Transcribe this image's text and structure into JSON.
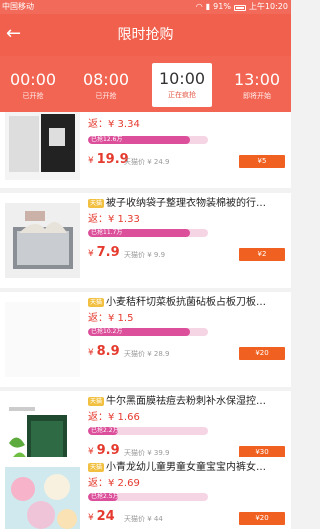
{
  "status_bar": {
    "carrier": "中国移动",
    "battery": "91%",
    "time": "上午10:20"
  },
  "header": {
    "back_glyph": "←",
    "title": "限时抢购"
  },
  "tabs": [
    {
      "time": "00:00",
      "status": "已开抢",
      "active": false
    },
    {
      "time": "08:00",
      "status": "已开抢",
      "active": false
    },
    {
      "time": "10:00",
      "status": "正在疯抢",
      "active": true
    },
    {
      "time": "13:00",
      "status": "即将开始",
      "active": false
    }
  ],
  "colors": {
    "accent": "#f0604c",
    "price": "#e53a2e",
    "progress": "#dc4f9a",
    "button": "#f06020"
  },
  "items": [
    {
      "tag": "",
      "title": "",
      "rebate": "返：¥ 3.34",
      "sold": "已抢12.6万",
      "sold_fraction": 0.85,
      "currency": "¥",
      "price": "19.9",
      "tmall_price": "天猫价 ¥ 24.9",
      "button": "¥5",
      "thumb": "box"
    },
    {
      "tag": "天猫",
      "title": "被子收纳袋子整理衣物装棉被的行…",
      "rebate": "返：¥ 1.33",
      "sold": "已抢11.7万",
      "sold_fraction": 0.85,
      "currency": "¥",
      "price": "7.9",
      "tmall_price": "天猫价 ¥ 9.9",
      "button": "¥2",
      "thumb": "storage"
    },
    {
      "tag": "天猫",
      "title": "小麦秸秆切菜板抗菌砧板占板刀板…",
      "rebate": "返：¥ 1.5",
      "sold": "已抢10.2万",
      "sold_fraction": 0.85,
      "currency": "¥",
      "price": "8.9",
      "tmall_price": "天猫价 ¥ 28.9",
      "button": "¥20",
      "thumb": "board"
    },
    {
      "tag": "天猫",
      "title": "牛尔黑面膜祛痘去粉刺补水保湿控…",
      "rebate": "返：¥ 1.66",
      "sold": "已抢2.2万",
      "sold_fraction": 0.25,
      "currency": "¥",
      "price": "9.9",
      "tmall_price": "天猫价 ¥ 39.9",
      "button": "¥30",
      "thumb": "mask"
    },
    {
      "tag": "天猫",
      "title": "小青龙幼儿童男童女童宝宝内裤女…",
      "rebate": "返：¥ 2.69",
      "sold": "已抢2.5万",
      "sold_fraction": 0.25,
      "currency": "¥",
      "price": "24",
      "tmall_price": "天猫价 ¥ 44",
      "button": "¥20",
      "thumb": "underwear"
    }
  ]
}
